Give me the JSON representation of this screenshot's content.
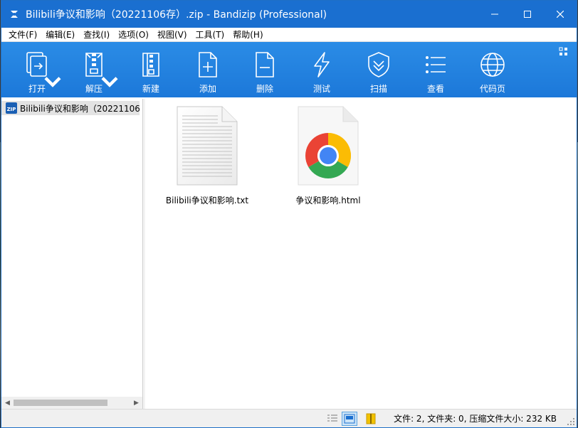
{
  "window": {
    "title": "Bilibili争议和影响（20221106存）.zip - Bandizip (Professional)",
    "accent": "#1a6fd0"
  },
  "menu": [
    "文件(F)",
    "编辑(E)",
    "查找(I)",
    "选项(O)",
    "视图(V)",
    "工具(T)",
    "帮助(H)"
  ],
  "toolbar": {
    "open": "打开",
    "extract": "解压",
    "new": "新建",
    "add": "添加",
    "delete": "删除",
    "test": "测试",
    "scan": "扫描",
    "view": "查看",
    "codepage": "代码页"
  },
  "tree": {
    "root": "Bilibili争议和影响（20221106存"
  },
  "files": [
    {
      "name": "Bilibili争议和影响.txt",
      "icon": "text-file-icon"
    },
    {
      "name": "争议和影响.html",
      "icon": "chrome-html-icon"
    }
  ],
  "status": {
    "text": "文件: 2, 文件夹: 0, 压缩文件大小: 232 KB"
  }
}
